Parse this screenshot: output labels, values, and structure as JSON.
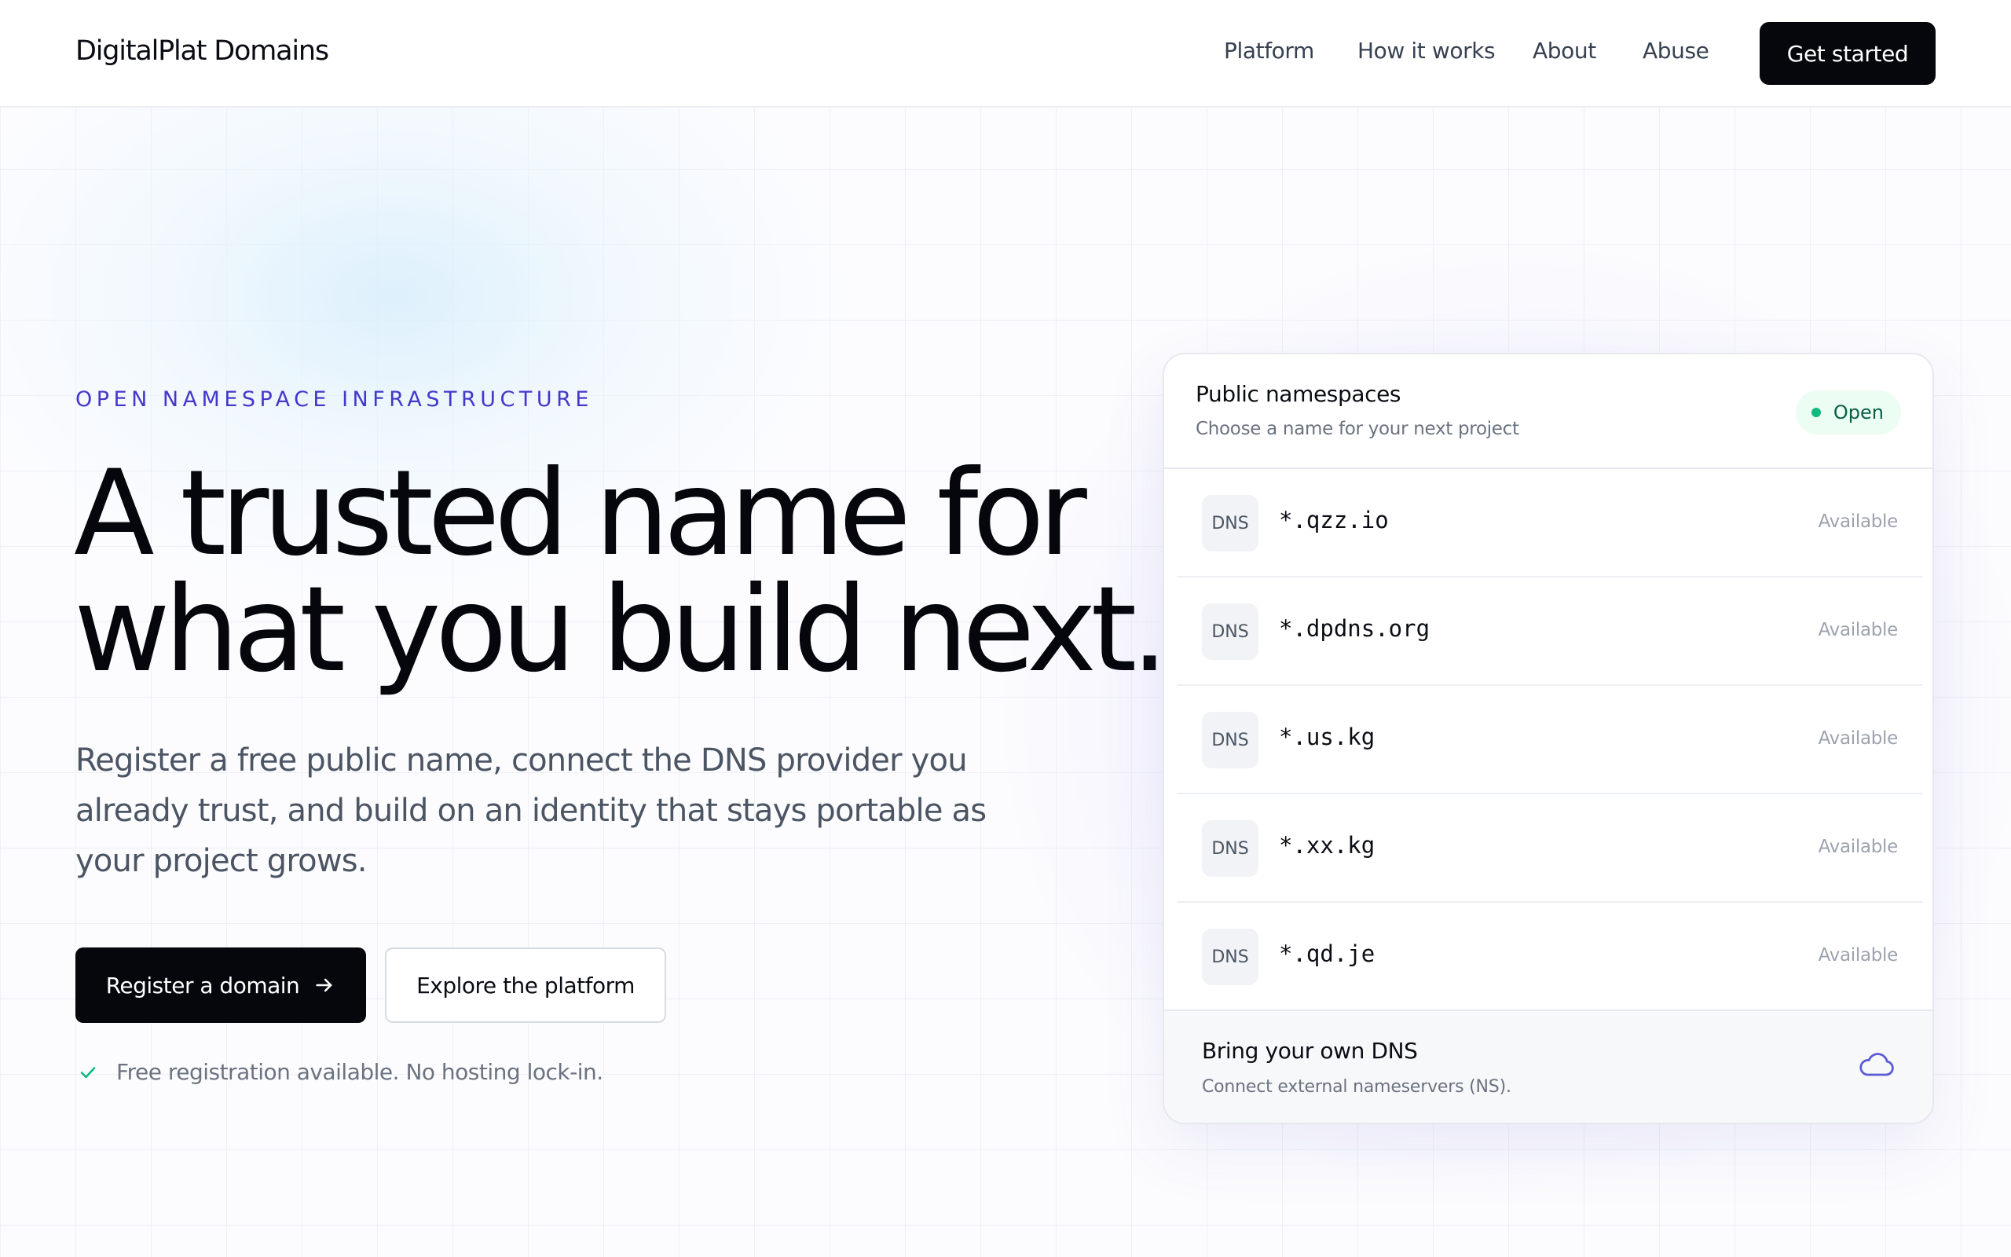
{
  "header": {
    "brand": "DigitalPlat Domains",
    "nav": [
      "Platform",
      "How it works",
      "About",
      "Abuse"
    ],
    "cta": "Get started"
  },
  "hero": {
    "eyebrow": "OPEN NAMESPACE INFRASTRUCTURE",
    "headline_line1": "A trusted name for",
    "headline_line2": "what you build next.",
    "subcopy": "Register a free public name, connect the DNS provider you already trust, and build on an identity that stays portable as your project grows.",
    "primary_button": "Register a domain",
    "secondary_button": "Explore the platform",
    "note": "Free registration available. No hosting lock-in."
  },
  "card": {
    "title": "Public namespaces",
    "subtitle": "Choose a name for your next project",
    "badge": "Open",
    "tag": "DNS",
    "status": "Available",
    "domains": [
      "*.qzz.io",
      "*.dpdns.org",
      "*.us.kg",
      "*.xx.kg",
      "*.qd.je"
    ],
    "footer_title": "Bring your own DNS",
    "footer_subtitle": "Connect external nameservers (NS)."
  },
  "colors": {
    "accent": "#4338ca",
    "ink": "#05070d",
    "status_green": "#10b981",
    "cloud_icon": "#5b5bd6"
  },
  "icons": [
    "arrow-right-icon",
    "check-icon",
    "cloud-icon",
    "status-dot-icon"
  ]
}
